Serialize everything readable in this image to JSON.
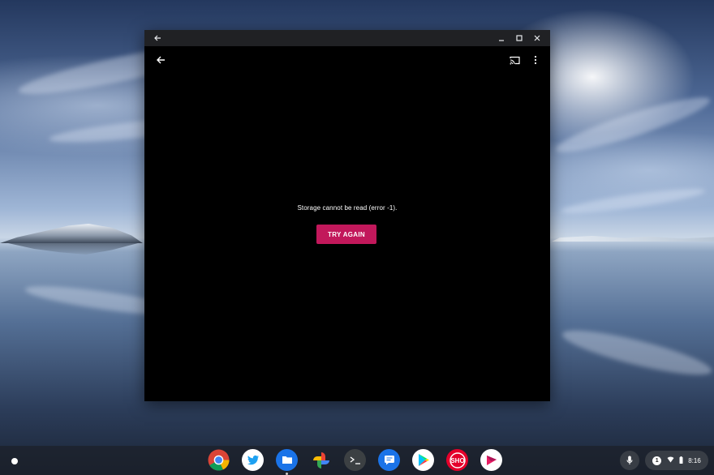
{
  "app_window": {
    "error_message": "Storage cannot be read (error -1).",
    "try_again_label": "TRY AGAIN",
    "accent_color": "#c2185b"
  },
  "titlebar": {
    "back_icon": "arrow-left-icon",
    "controls": [
      "minimize-icon",
      "maximize-icon",
      "close-icon"
    ]
  },
  "appbar": {
    "back_icon": "arrow-left-icon",
    "cast_icon": "cast-icon",
    "more_icon": "more-vert-icon"
  },
  "shelf": {
    "apps": [
      "chrome",
      "twitter",
      "files",
      "google-photos",
      "terminal",
      "messages",
      "play-store",
      "showtime",
      "infuse"
    ],
    "status": {
      "notification_count": "1",
      "time": "8:16"
    }
  }
}
